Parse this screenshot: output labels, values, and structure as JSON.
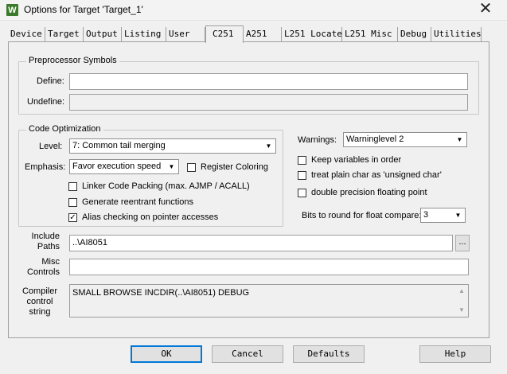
{
  "window": {
    "title": "Options for Target 'Target_1'",
    "icon": "keil-uvision-icon"
  },
  "tabs": [
    "Device",
    "Target",
    "Output",
    "Listing",
    "User",
    "C251",
    "A251",
    "L251 Locate",
    "L251 Misc",
    "Debug",
    "Utilities"
  ],
  "active_tab": "C251",
  "preprocessor": {
    "group_label": "Preprocessor Symbols",
    "define_label": "Define:",
    "define_value": "",
    "undefine_label": "Undefine:",
    "undefine_value": ""
  },
  "code_optimization": {
    "group_label": "Code Optimization",
    "level_label": "Level:",
    "level_value": "7: Common tail merging",
    "emphasis_label": "Emphasis:",
    "emphasis_value": "Favor execution speed",
    "register_coloring": {
      "label": "Register Coloring",
      "checked": false
    },
    "linker_code_packing": {
      "label": "Linker Code Packing (max. AJMP / ACALL)",
      "checked": false
    },
    "generate_reentrant": {
      "label": "Generate reentrant functions",
      "checked": false
    },
    "alias_checking": {
      "label": "Alias checking on pointer accesses",
      "checked": true
    }
  },
  "warnings": {
    "label": "Warnings:",
    "value": "Warninglevel 2",
    "keep_variables": {
      "label": "Keep variables in order",
      "checked": false
    },
    "plain_char": {
      "label": "treat plain char as 'unsigned char'",
      "checked": false
    },
    "double_precision": {
      "label": "double precision floating point",
      "checked": false
    },
    "bits_round_label": "Bits to round for float compare:",
    "bits_round_value": "3"
  },
  "include_paths": {
    "label_line1": "Include",
    "label_line2": "Paths",
    "value": "..\\AI8051",
    "browse_label": "..."
  },
  "misc_controls": {
    "label_line1": "Misc",
    "label_line2": "Controls",
    "value": ""
  },
  "compiler_control": {
    "label_line1": "Compiler",
    "label_line2": "control",
    "label_line3": "string",
    "value": "SMALL BROWSE INCDIR(..\\AI8051) DEBUG"
  },
  "buttons": {
    "ok": "OK",
    "cancel": "Cancel",
    "defaults": "Defaults",
    "help": "Help"
  },
  "check_mark": "✓",
  "close_glyph": "✕",
  "arrow_glyph": "▼",
  "scroll_up_glyph": "▲",
  "scroll_down_glyph": "▼",
  "icon_letter": "W"
}
